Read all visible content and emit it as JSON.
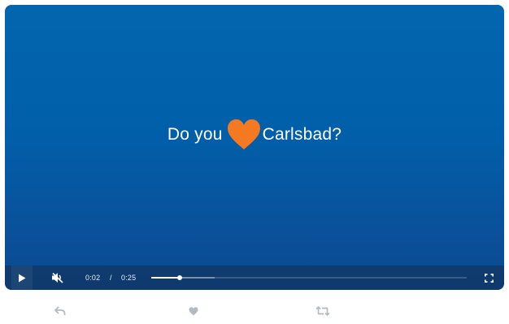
{
  "video": {
    "title_before": "Do you",
    "title_after": "Carlsbad?",
    "heart_icon": "heart-icon",
    "heart_color": "#f47920"
  },
  "controls": {
    "play_icon": "play-icon",
    "mute_icon": "volume-muted-icon",
    "current_time": "0:02",
    "separator": "/",
    "total_time": "0:25",
    "progress_fraction": 0.09,
    "buffered_fraction": 0.2,
    "fullscreen_icon": "fullscreen-icon"
  },
  "actions": {
    "reply_icon": "reply-icon",
    "like_icon": "heart-icon",
    "retweet_icon": "retweet-icon"
  }
}
